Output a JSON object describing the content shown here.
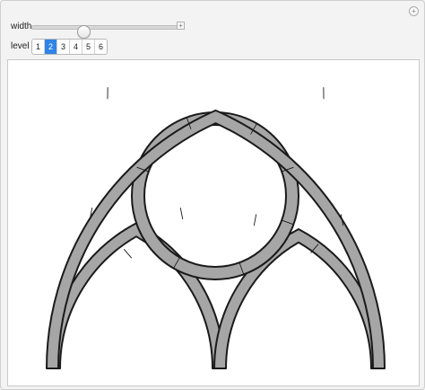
{
  "controls": {
    "width_label": "width",
    "width_value": 0.34,
    "level_label": "level",
    "levels": [
      "1",
      "2",
      "3",
      "4",
      "5",
      "6"
    ],
    "selected_level": "2"
  },
  "colors": {
    "stone_fill": "#a6a6a6",
    "outline": "#1a1a1a",
    "accent": "#2f84e6"
  },
  "icons": {
    "panel_plus": "plus-icon",
    "slider_plus": "plus-icon"
  }
}
